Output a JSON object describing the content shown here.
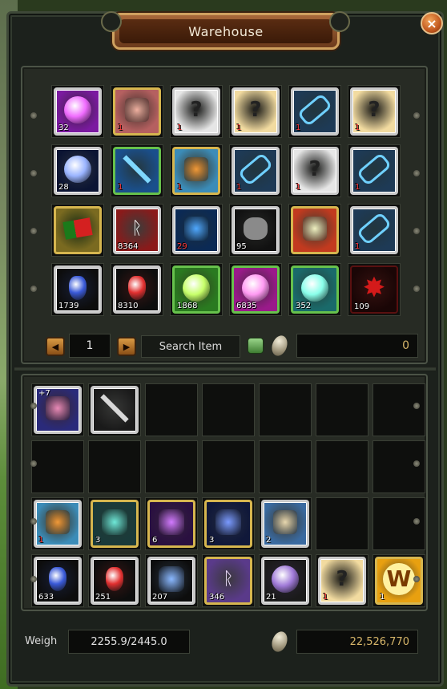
{
  "window": {
    "title": "Warehouse",
    "close_label": "×"
  },
  "warehouse": {
    "items": [
      {
        "icon": "purple-orb-icon",
        "qty": "32",
        "frame": "silver",
        "bg": "#7b1aa0",
        "accent": "#f06cff",
        "qty_color": "white"
      },
      {
        "icon": "gloved-hand-icon",
        "qty": "1",
        "frame": "gold",
        "bg": "#b56060",
        "accent": "#f0b0a0",
        "qty_color": "red"
      },
      {
        "icon": "unknown-item-icon",
        "qty": "1",
        "frame": "silver",
        "bg": "#e6e6e6",
        "accent": "#222222",
        "qty_color": "red"
      },
      {
        "icon": "unknown-armor-icon",
        "qty": "1",
        "frame": "silver",
        "bg": "#f2dba0",
        "accent": "#222222",
        "qty_color": "red"
      },
      {
        "icon": "blue-chain-icon",
        "qty": "1",
        "frame": "silver",
        "bg": "#1e3a56",
        "accent": "#6fd0ff",
        "qty_color": "red"
      },
      {
        "icon": "unknown-armor-icon",
        "qty": "1",
        "frame": "silver",
        "bg": "#f2dba0",
        "accent": "#222222",
        "qty_color": "red"
      },
      {
        "icon": "blue-sphere-icon",
        "qty": "28",
        "frame": "silver",
        "bg": "#0b1433",
        "accent": "#9ab4ff",
        "qty_color": "white"
      },
      {
        "icon": "blue-sword-icon",
        "qty": "1",
        "frame": "green",
        "bg": "#1a4f8c",
        "accent": "#7fd8ff",
        "qty_color": "red"
      },
      {
        "icon": "scroll-swirl-icon",
        "qty": "1",
        "frame": "gold",
        "bg": "#3b8cb8",
        "accent": "#f09a3a",
        "qty_color": "red"
      },
      {
        "icon": "blue-chain-icon",
        "qty": "1",
        "frame": "silver",
        "bg": "#1e3a56",
        "accent": "#6fd0ff",
        "qty_color": "red"
      },
      {
        "icon": "unknown-item-icon",
        "qty": "1",
        "frame": "silver",
        "bg": "#e6e6e6",
        "accent": "#222222",
        "qty_color": "red"
      },
      {
        "icon": "blue-chain-icon",
        "qty": "1",
        "frame": "silver",
        "bg": "#1e3a56",
        "accent": "#6fd0ff",
        "qty_color": "red"
      },
      {
        "icon": "flag-icon",
        "qty": "",
        "frame": "gold",
        "bg": "#7a6a20",
        "accent": "#2a8a2a",
        "qty_color": "white"
      },
      {
        "icon": "rune-stone-icon",
        "qty": "8364",
        "frame": "silver",
        "bg": "#8b1a1a",
        "accent": "#f0f0f0",
        "qty_color": "white"
      },
      {
        "icon": "blue-whip-icon",
        "qty": "29",
        "frame": "silver",
        "bg": "#0b2a55",
        "accent": "#4fa8ff",
        "qty_color": "red"
      },
      {
        "icon": "grey-ore-icon",
        "qty": "95",
        "frame": "silver",
        "bg": "#111111",
        "accent": "#8a8a8a",
        "qty_color": "white"
      },
      {
        "icon": "house-gem-icon",
        "qty": "",
        "frame": "gold",
        "bg": "#c23a1f",
        "accent": "#f0f0c0",
        "qty_color": "white"
      },
      {
        "icon": "blue-chain-icon",
        "qty": "1",
        "frame": "silver",
        "bg": "#1e3a56",
        "accent": "#6fd0ff",
        "qty_color": "red"
      },
      {
        "icon": "blue-potion-icon",
        "qty": "1739",
        "frame": "silver",
        "bg": "#0d0d0d",
        "accent": "#3a5ad8",
        "qty_color": "white"
      },
      {
        "icon": "red-potion-icon",
        "qty": "8310",
        "frame": "silver",
        "bg": "#0d0d0d",
        "accent": "#e23030",
        "qty_color": "white"
      },
      {
        "icon": "green-egg-icon",
        "qty": "1868",
        "frame": "green",
        "bg": "#2a7a20",
        "accent": "#c7ff6a",
        "qty_color": "white"
      },
      {
        "icon": "pink-egg-icon",
        "qty": "6835",
        "frame": "green",
        "bg": "#9a1a8a",
        "accent": "#ff9af2",
        "qty_color": "white"
      },
      {
        "icon": "teal-egg-icon",
        "qty": "352",
        "frame": "green",
        "bg": "#1a6a6a",
        "accent": "#8affea",
        "qty_color": "white"
      },
      {
        "icon": "red-burst-icon",
        "qty": "109",
        "frame": "red",
        "bg": "#1a0606",
        "accent": "#d41a1a",
        "qty_color": "white"
      }
    ],
    "page": "1",
    "search_label": "Search Item",
    "gold": "0"
  },
  "inventory": {
    "items": [
      {
        "icon": "shield-emblem-icon",
        "qty": "",
        "plus": "+7",
        "frame": "silver",
        "bg": "#2a2a7a",
        "accent": "#e88ab8",
        "qty_color": "white"
      },
      {
        "icon": "sword-icon",
        "qty": "",
        "plus": "",
        "frame": "silver",
        "bg": "#1a1a1a",
        "accent": "#d8d8d8",
        "qty_color": "white"
      },
      null,
      null,
      null,
      null,
      null,
      null,
      null,
      null,
      null,
      null,
      null,
      null,
      {
        "icon": "scroll-swirl-icon",
        "qty": "1",
        "plus": "",
        "frame": "silver",
        "bg": "#3b8cb8",
        "accent": "#f09a3a",
        "qty_color": "red"
      },
      {
        "icon": "teal-skull-gem-icon",
        "qty": "3",
        "plus": "",
        "frame": "gold",
        "bg": "#1a3a3a",
        "accent": "#6fe8d8",
        "qty_color": "white"
      },
      {
        "icon": "purple-skull-gem-icon",
        "qty": "6",
        "plus": "",
        "frame": "gold",
        "bg": "#2a1040",
        "accent": "#d27aff",
        "qty_color": "white"
      },
      {
        "icon": "blue-skull-gem-icon",
        "qty": "3",
        "plus": "",
        "frame": "gold",
        "bg": "#10183a",
        "accent": "#7a9aff",
        "qty_color": "white"
      },
      {
        "icon": "parchment-icon",
        "qty": "2",
        "plus": "",
        "frame": "silver",
        "bg": "#3a6aa0",
        "accent": "#e8d8b0",
        "qty_color": "white"
      },
      null,
      null,
      {
        "icon": "blue-potion-icon",
        "qty": "633",
        "plus": "",
        "frame": "silver",
        "bg": "#0d0d0d",
        "accent": "#3a5ad8",
        "qty_color": "white"
      },
      {
        "icon": "red-potion-icon",
        "qty": "251",
        "plus": "",
        "frame": "silver",
        "bg": "#0d0d0d",
        "accent": "#e23030",
        "qty_color": "white"
      },
      {
        "icon": "blue-crystal-icon",
        "qty": "207",
        "plus": "",
        "frame": "silver",
        "bg": "#0d0d0d",
        "accent": "#8ab8ff",
        "qty_color": "white"
      },
      {
        "icon": "purple-rune-icon",
        "qty": "346",
        "plus": "",
        "frame": "gold",
        "bg": "#5a3a8a",
        "accent": "#f0e0ff",
        "qty_color": "white"
      },
      {
        "icon": "purple-portal-icon",
        "qty": "21",
        "plus": "",
        "frame": "silver",
        "bg": "#1a1a1a",
        "accent": "#a07ad8",
        "qty_color": "white"
      },
      {
        "icon": "unknown-armor-icon",
        "qty": "1",
        "plus": "",
        "frame": "silver",
        "bg": "#f2dba0",
        "accent": "#222222",
        "qty_color": "red"
      },
      {
        "icon": "gold-coin-w-icon",
        "qty": "1",
        "plus": "",
        "frame": "gold",
        "bg": "#e8a010",
        "accent": "#fff1a0",
        "qty_color": "white"
      }
    ]
  },
  "footer": {
    "weight_label": "Weigh",
    "weight_value": "2255.9/2445.0",
    "money": "22,526,770"
  }
}
